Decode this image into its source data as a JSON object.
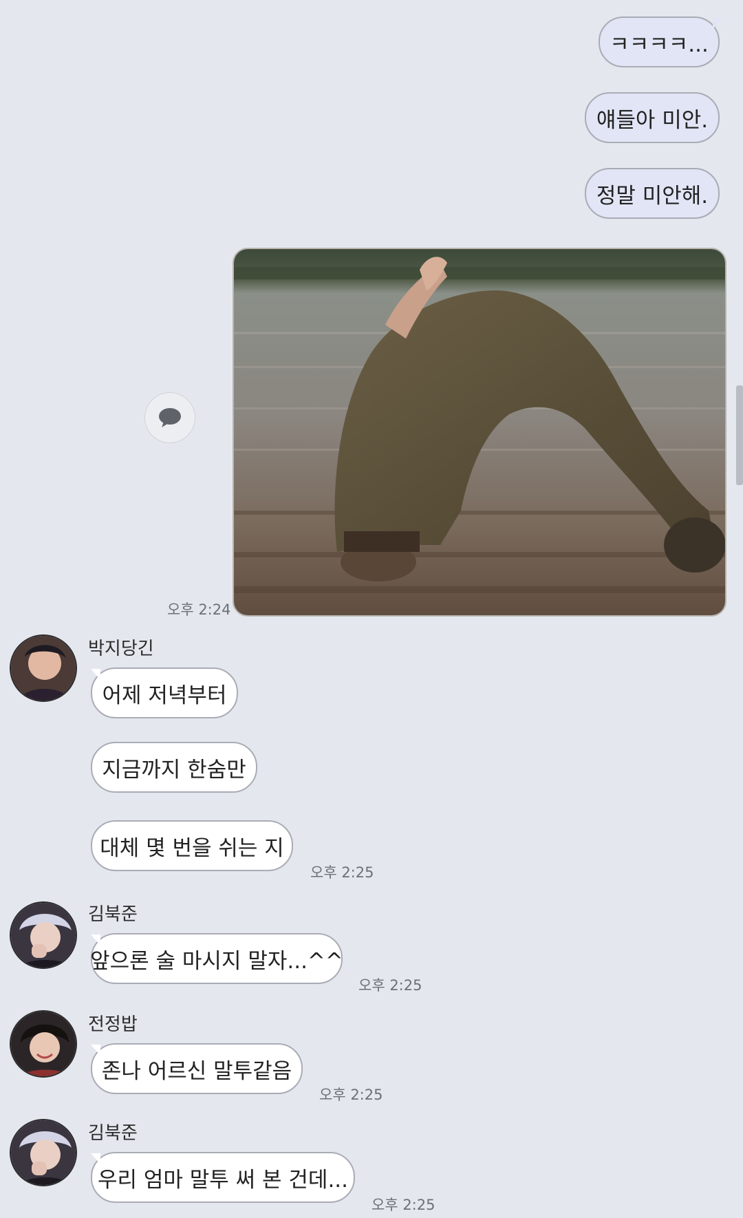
{
  "messages_out": [
    {
      "text": "ㅋㅋㅋㅋ..."
    },
    {
      "text": "얘들아 미안."
    },
    {
      "text": "정말 미안해."
    }
  ],
  "photo": {
    "description": "photo-message",
    "time": "오후 2:24"
  },
  "groups": [
    {
      "sender": "박지당긴",
      "avatar_icon": "profile-photo-icon",
      "messages": [
        "어제 저녁부터",
        "지금까지 한숨만",
        "대체 몇 번을 쉬는 지"
      ],
      "time": "오후 2:25"
    },
    {
      "sender": "김북준",
      "avatar_icon": "profile-photo-icon",
      "messages": [
        "앞으론 술 마시지 말자...^^"
      ],
      "time": "오후 2:25"
    },
    {
      "sender": "전정밥",
      "avatar_icon": "profile-photo-icon",
      "messages": [
        "존나 어르신 말투같음"
      ],
      "time": "오후 2:25"
    },
    {
      "sender": "김북준",
      "avatar_icon": "profile-photo-icon",
      "messages": [
        "우리 엄마 말투 써 본 건데..."
      ],
      "time": "오후 2:25"
    }
  ],
  "colors": {
    "background": "#e4e7ee",
    "bubble_out": "#e1e5f5",
    "bubble_in": "#ffffff",
    "bubble_border": "#a9acb5"
  },
  "icons": {
    "reply": "speech-bubble-icon"
  }
}
